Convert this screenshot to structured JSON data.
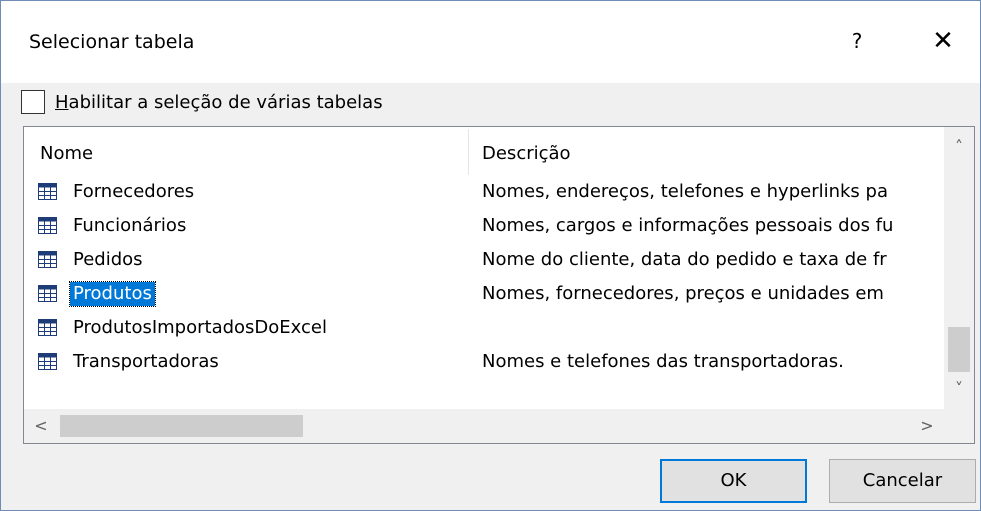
{
  "dialog": {
    "title": "Selecionar tabela",
    "help_label": "?",
    "close_label": "✕"
  },
  "multi_select": {
    "label_accel": "H",
    "label_rest": "abilitar a seleção de várias tabelas",
    "checked": false
  },
  "table": {
    "columns": [
      "Nome",
      "Descrição"
    ],
    "rows": [
      {
        "name": "Fornecedores",
        "desc": "Nomes, endereços, telefones e hyperlinks pa",
        "icon": "table-icon"
      },
      {
        "name": "Funcionários",
        "desc": "Nomes, cargos e informações pessoais dos fu",
        "icon": "table-icon"
      },
      {
        "name": "Pedidos",
        "desc": "Nome do cliente, data do pedido e taxa de fr",
        "icon": "table-icon"
      },
      {
        "name": "Produtos",
        "desc": "Nomes, fornecedores, preços e unidades em",
        "icon": "table-icon",
        "selected": true
      },
      {
        "name": "ProdutosImportadosDoExcel",
        "desc": "",
        "icon": "table-icon"
      },
      {
        "name": "Transportadoras",
        "desc": "Nomes e telefones das transportadoras.",
        "icon": "table-icon"
      }
    ]
  },
  "scrollbars": {
    "up": "˄",
    "down": "˅",
    "left": "<",
    "right": ">"
  },
  "buttons": {
    "ok": "OK",
    "cancel": "Cancelar"
  },
  "colors": {
    "selection": "#0078d7",
    "icon_blue": "#1e3c78"
  }
}
